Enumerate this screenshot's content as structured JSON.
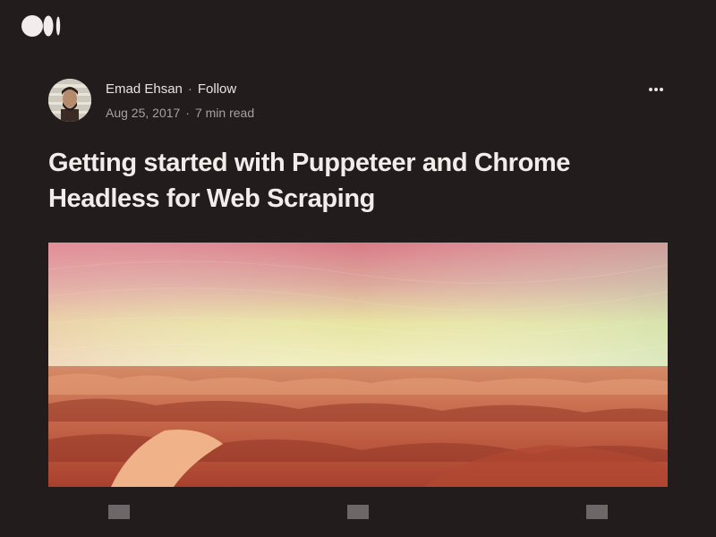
{
  "app": {
    "logo_icon": "medium-logo-icon"
  },
  "article": {
    "author": {
      "name": "Emad Ehsan",
      "follow_label": "Follow",
      "avatar_icon": "author-avatar"
    },
    "date": "Aug 25, 2017",
    "read_time": "7 min read",
    "separator": "·",
    "title": "Getting started with Puppeteer and Chrome Headless for Web Scraping",
    "hero_image": "desert-dunes-hero-image",
    "more_icon": "more-options-icon"
  },
  "bottom_bar": {
    "icons": [
      "bottom-action-1-icon",
      "bottom-action-2-icon",
      "bottom-action-3-icon"
    ]
  },
  "colors": {
    "background": "#231c1d",
    "text": "#f2ecea",
    "muted": "#a8a09d"
  }
}
